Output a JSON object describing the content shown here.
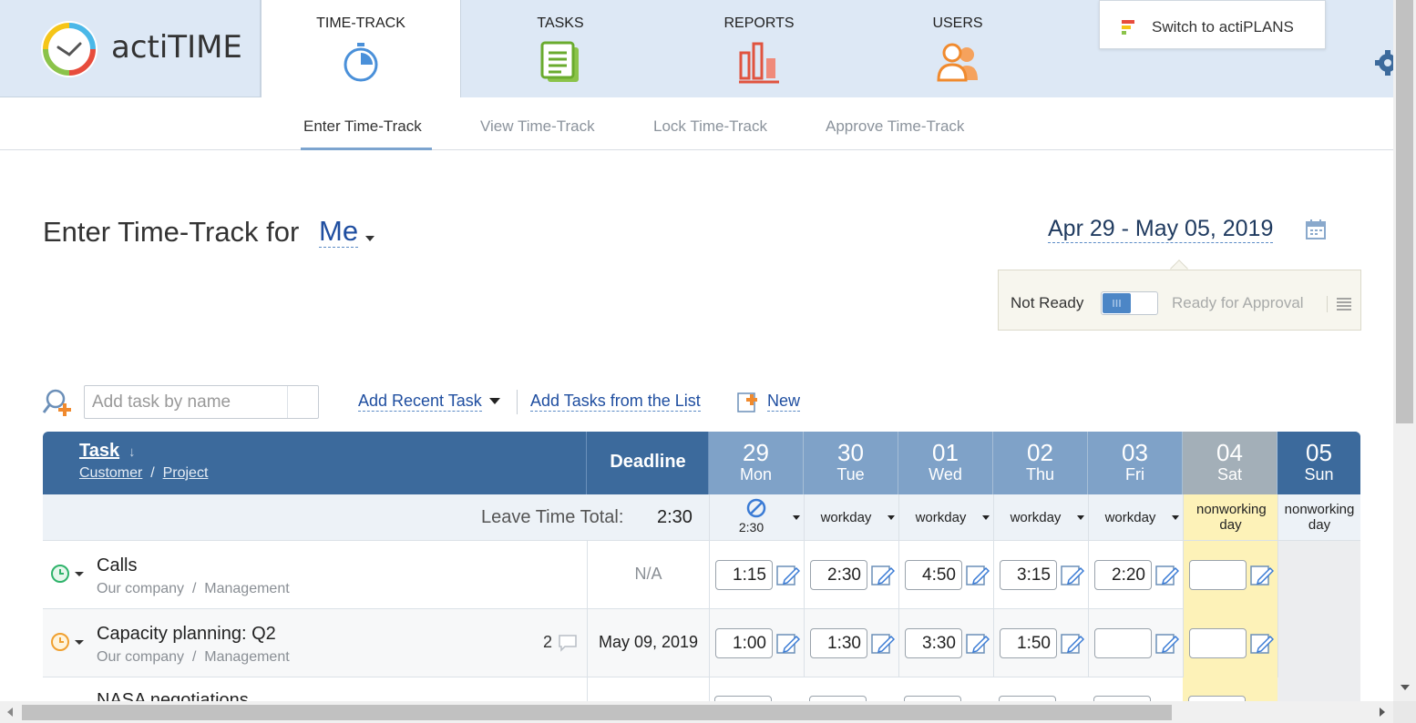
{
  "app": {
    "logo_text": "actiTIME"
  },
  "nav": {
    "tabs": [
      {
        "label": "TIME-TRACK",
        "icon": "stopwatch-icon",
        "active": true
      },
      {
        "label": "TASKS",
        "icon": "clipboard-icon",
        "active": false
      },
      {
        "label": "REPORTS",
        "icon": "bar-chart-icon",
        "active": false
      },
      {
        "label": "USERS",
        "icon": "users-icon",
        "active": false
      }
    ],
    "switch_label": "Switch to actiPLANS",
    "settings_icon": "gear-icon"
  },
  "subnav": {
    "tabs": [
      {
        "label": "Enter Time-Track",
        "active": true
      },
      {
        "label": "View Time-Track",
        "active": false
      },
      {
        "label": "Lock Time-Track",
        "active": false
      },
      {
        "label": "Approve Time-Track",
        "active": false
      }
    ]
  },
  "header": {
    "title": "Enter Time-Track for",
    "user": "Me",
    "date_range": "Apr 29 - May 05, 2019"
  },
  "status": {
    "not_ready": "Not Ready",
    "ready": "Ready for Approval",
    "toggle_on": false
  },
  "add_task": {
    "placeholder": "Add task by name",
    "recent": "Add Recent Task",
    "from_list": "Add Tasks from the List",
    "new": "New"
  },
  "table": {
    "task_col": "Task",
    "customer": "Customer",
    "project": "Project",
    "deadline_col": "Deadline",
    "days": [
      {
        "num": "29",
        "name": "Mon",
        "status": "2:30",
        "leave_icon": "no-entry-icon"
      },
      {
        "num": "30",
        "name": "Tue",
        "status": "workday"
      },
      {
        "num": "01",
        "name": "Wed",
        "status": "workday"
      },
      {
        "num": "02",
        "name": "Thu",
        "status": "workday"
      },
      {
        "num": "03",
        "name": "Fri",
        "status": "workday"
      },
      {
        "num": "04",
        "name": "Sat",
        "status": "nonworking day"
      },
      {
        "num": "05",
        "name": "Sun",
        "status": "nonworking day"
      }
    ],
    "leave_label": "Leave Time Total:",
    "leave_total": "2:30",
    "rows": [
      {
        "name": "Calls",
        "customer": "Our company",
        "project": "Management",
        "deadline": "N/A",
        "icon": "clock-green-icon",
        "comments": "",
        "times": [
          "1:15",
          "2:30",
          "4:50",
          "3:15",
          "2:20",
          ""
        ]
      },
      {
        "name": "Capacity planning: Q2",
        "customer": "Our company",
        "project": "Management",
        "deadline": "May 09, 2019",
        "icon": "clock-orange-icon",
        "comments": "2",
        "times": [
          "1:00",
          "1:30",
          "3:30",
          "1:50",
          "",
          ""
        ]
      }
    ],
    "partial_row_name": "NASA negotiations"
  },
  "colors": {
    "accent": "#3c6a9c",
    "link": "#1f4ea0",
    "header_bg": "#dde8f5",
    "weekday_header": "#7fa2c8",
    "saturday": "#fdf2b8"
  }
}
